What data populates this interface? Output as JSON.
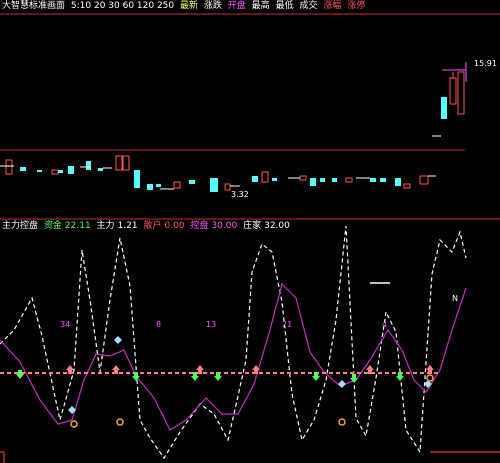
{
  "main_header": {
    "title": "大智慧标准画面",
    "ma_values": "5:10 20 30 60 120 250",
    "fields": [
      "最新",
      "涨跌",
      "开盘",
      "最高",
      "最低",
      "成交",
      "涨幅"
    ],
    "tail": "涨停"
  },
  "price_panel": {
    "high_label": "15.91",
    "low_label": "3.32"
  },
  "indicator_header": {
    "name": "主力控盘",
    "items": [
      {
        "label": "资金",
        "value": "22.11",
        "color": "#54ff54"
      },
      {
        "label": "主力",
        "value": "1.21",
        "color": "#ffffff"
      },
      {
        "label": "散户",
        "value": "0.00",
        "color": "#ff5454"
      },
      {
        "label": "控盘",
        "value": "30.00",
        "color": "#ff54ff"
      },
      {
        "label": "庄家",
        "value": "32.00",
        "color": "#ffffff"
      }
    ]
  },
  "indicator_labels": [
    {
      "text": "34",
      "color": "#ff54ff"
    },
    {
      "text": "8",
      "color": "#ff54ff"
    },
    {
      "text": "13",
      "color": "#ff54ff"
    },
    {
      "text": "21",
      "color": "#ff54ff"
    },
    {
      "text": "4",
      "color": "#ff54ff"
    },
    {
      "text": "N",
      "color": "#ffffff"
    }
  ],
  "colors": {
    "up": "#ff5454",
    "down": "#54ffff",
    "divider": "#c03030",
    "dashed": "#ffffff",
    "purple": "#c030c0",
    "level": "#ff8080",
    "buy": "#54ff54",
    "sell": "#ff8040"
  },
  "icons": [
    "up-arrow-icon",
    "down-arrow-icon",
    "diamond-icon",
    "target-icon"
  ]
}
